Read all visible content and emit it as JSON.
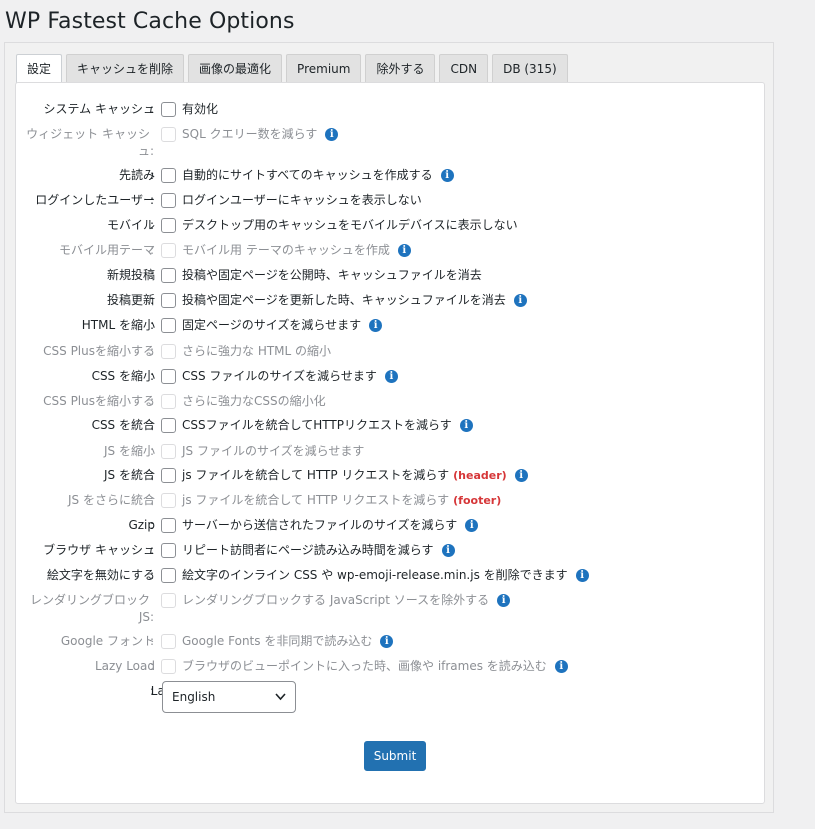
{
  "page": {
    "title": "WP Fastest Cache Options"
  },
  "tabs": [
    {
      "label": "設定",
      "active": true
    },
    {
      "label": "キャッシュを削除"
    },
    {
      "label": "画像の最適化"
    },
    {
      "label": "Premium"
    },
    {
      "label": "除外する"
    },
    {
      "label": "CDN"
    },
    {
      "label": "DB (315)"
    }
  ],
  "options": [
    {
      "label": "システム キャッシュ",
      "text": "有効化",
      "disabled": false,
      "info": false
    },
    {
      "label": "ウィジェット キャッシュ",
      "text": "SQL クエリー数を減らす",
      "disabled": true,
      "info": true
    },
    {
      "label": "先読み",
      "text": "自動的にサイトすべてのキャッシュを作成する",
      "disabled": false,
      "info": true
    },
    {
      "label": "ログインしたユーザー",
      "text": "ログインユーザーにキャッシュを表示しない",
      "disabled": false,
      "info": false
    },
    {
      "label": "モバイル",
      "text": "デスクトップ用のキャッシュをモバイルデバイスに表示しない",
      "disabled": false,
      "info": false
    },
    {
      "label": "モバイル用テーマ",
      "text": "モバイル用 テーマのキャッシュを作成",
      "disabled": true,
      "info": true
    },
    {
      "label": "新規投稿",
      "text": "投稿や固定ページを公開時、キャッシュファイルを消去",
      "disabled": false,
      "info": false
    },
    {
      "label": "投稿更新",
      "text": "投稿や固定ページを更新した時、キャッシュファイルを消去",
      "disabled": false,
      "info": true
    },
    {
      "label": "HTML を縮小",
      "text": "固定ページのサイズを減らせます",
      "disabled": false,
      "info": true
    },
    {
      "label": "CSS Plusを縮小する",
      "text": "さらに強力な HTML の縮小",
      "disabled": true,
      "info": false
    },
    {
      "label": "CSS を縮小",
      "text": "CSS ファイルのサイズを減らせます",
      "disabled": false,
      "info": true
    },
    {
      "label": "CSS Plusを縮小する",
      "text": "さらに強力なCSSの縮小化",
      "disabled": true,
      "info": false
    },
    {
      "label": "CSS を統合",
      "text": "CSSファイルを統合してHTTPリクエストを減らす",
      "disabled": false,
      "info": true
    },
    {
      "label": "JS を縮小",
      "text": "JS ファイルのサイズを減らせます",
      "disabled": true,
      "info": false
    },
    {
      "label": "JS を統合",
      "text": "js ファイルを統合して HTTP リクエストを減らす",
      "tag": "(header)",
      "disabled": false,
      "info": true
    },
    {
      "label": "JS をさらに統合",
      "text": "js ファイルを統合して HTTP リクエストを減らす",
      "tag": "(footer)",
      "disabled": true,
      "info": false
    },
    {
      "label": "Gzip",
      "text": "サーバーから送信されたファイルのサイズを減らす",
      "disabled": false,
      "info": true
    },
    {
      "label": "ブラウザ キャッシュ",
      "text": "リピート訪問者にページ読み込み時間を減らす",
      "disabled": false,
      "info": true
    },
    {
      "label": "絵文字を無効にする",
      "text": "絵文字のインライン CSS や wp-emoji-release.min.js を削除できます",
      "disabled": false,
      "info": true
    },
    {
      "label": "レンダリングブロック JS",
      "text": "レンダリングブロックする JavaScript ソースを除外する",
      "disabled": true,
      "info": true
    },
    {
      "label": "Google フォント",
      "text": "Google Fonts を非同期で読み込む",
      "disabled": true,
      "info": true
    },
    {
      "label": "Lazy Load",
      "text": "ブラウザのビューポイントに入った時、画像や iframes を読み込む",
      "disabled": true,
      "info": true
    }
  ],
  "language": {
    "label": "Language",
    "value": "English"
  },
  "submit_label": "Submit",
  "colon": ":",
  "info_glyph": "i",
  "colors": {
    "accent": "#2271b1",
    "info": "#1e73be",
    "tag": "#d63638"
  }
}
